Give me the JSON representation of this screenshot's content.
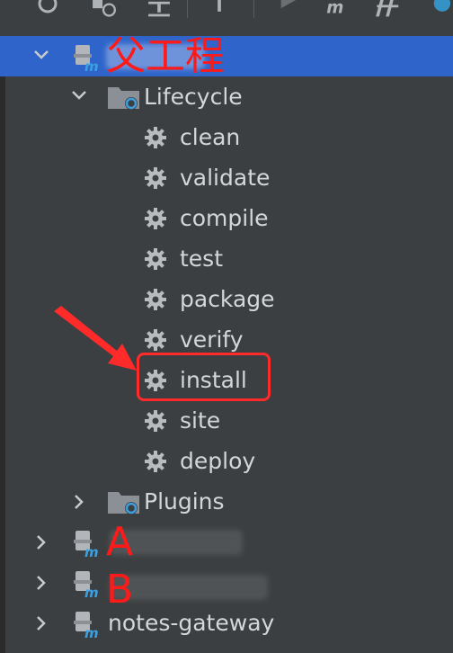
{
  "root": {
    "annotation": "父工程"
  },
  "lifecycle": {
    "label": "Lifecycle",
    "phases": [
      "clean",
      "validate",
      "compile",
      "test",
      "package",
      "verify",
      "install",
      "site",
      "deploy"
    ]
  },
  "plugins": {
    "label": "Plugins"
  },
  "modules": [
    {
      "annotation": "A"
    },
    {
      "annotation": "B"
    },
    {
      "label": "notes-gateway"
    }
  ],
  "colors": {
    "background": "#3c3f41",
    "selection": "#2f65ca",
    "annotation_red": "#ff2a2a"
  },
  "icons": {
    "module": "maven-module-icon",
    "folder": "lifecycle-folder-icon",
    "phase": "gear-icon"
  }
}
